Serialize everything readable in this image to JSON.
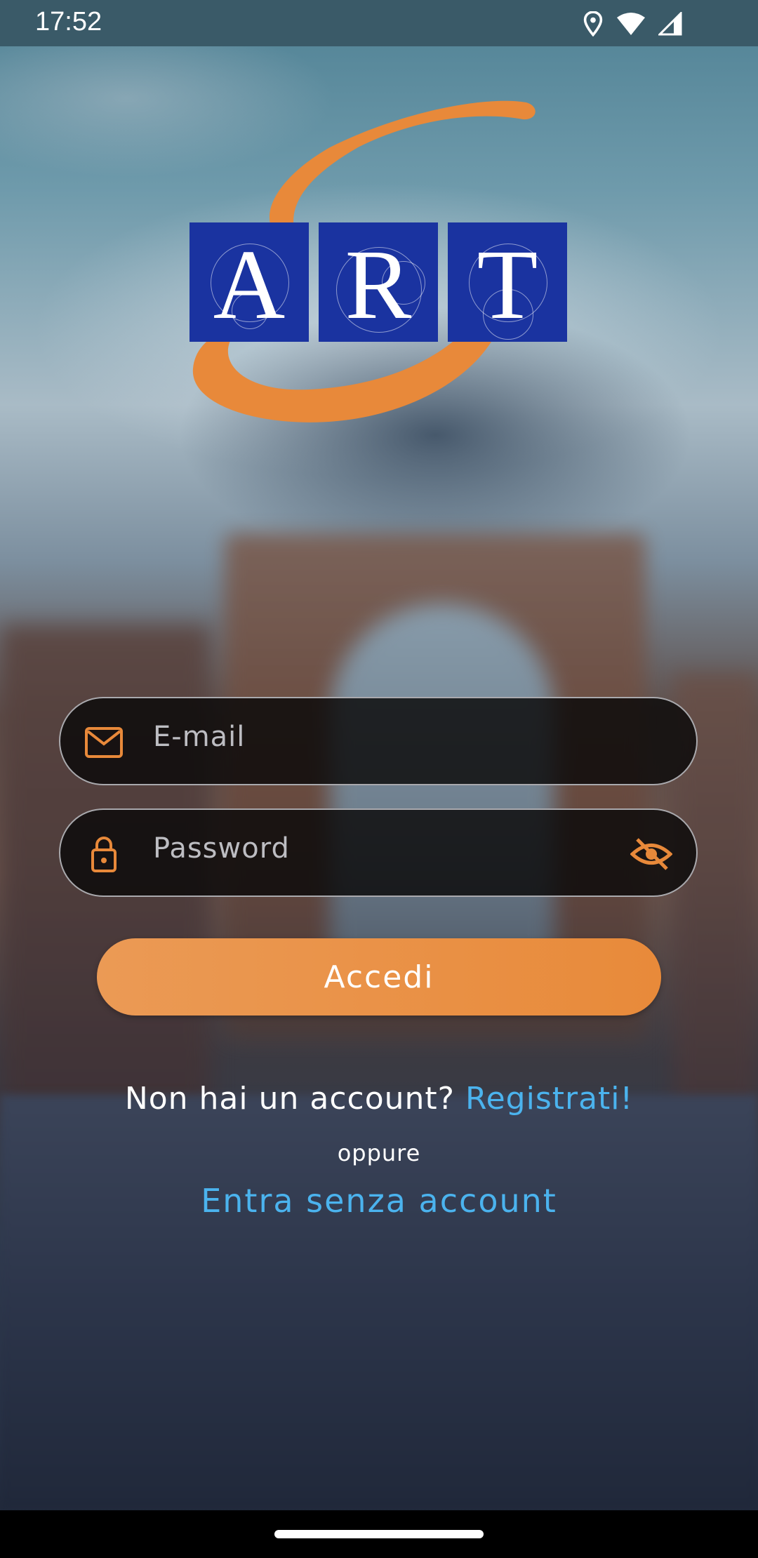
{
  "status_bar": {
    "time": "17:52",
    "icons": [
      "location-icon",
      "wifi-icon",
      "cellular-signal-icon"
    ]
  },
  "logo": {
    "letters": [
      "A",
      "R",
      "T"
    ],
    "colors": {
      "tile": "#1a33a0",
      "swoosh": "#e8893a"
    }
  },
  "form": {
    "email": {
      "placeholder": "E-mail",
      "icon": "mail-icon"
    },
    "password": {
      "placeholder": "Password",
      "icon": "lock-icon",
      "toggle_icon": "eye-off-icon"
    },
    "submit_label": "Accedi"
  },
  "signup": {
    "prompt": "Non hai un account?",
    "link": "Registrati!"
  },
  "or_text": "oppure",
  "guest_link": "Entra senza account",
  "colors": {
    "accent": "#e88a3a",
    "link": "#4bb3ee"
  }
}
